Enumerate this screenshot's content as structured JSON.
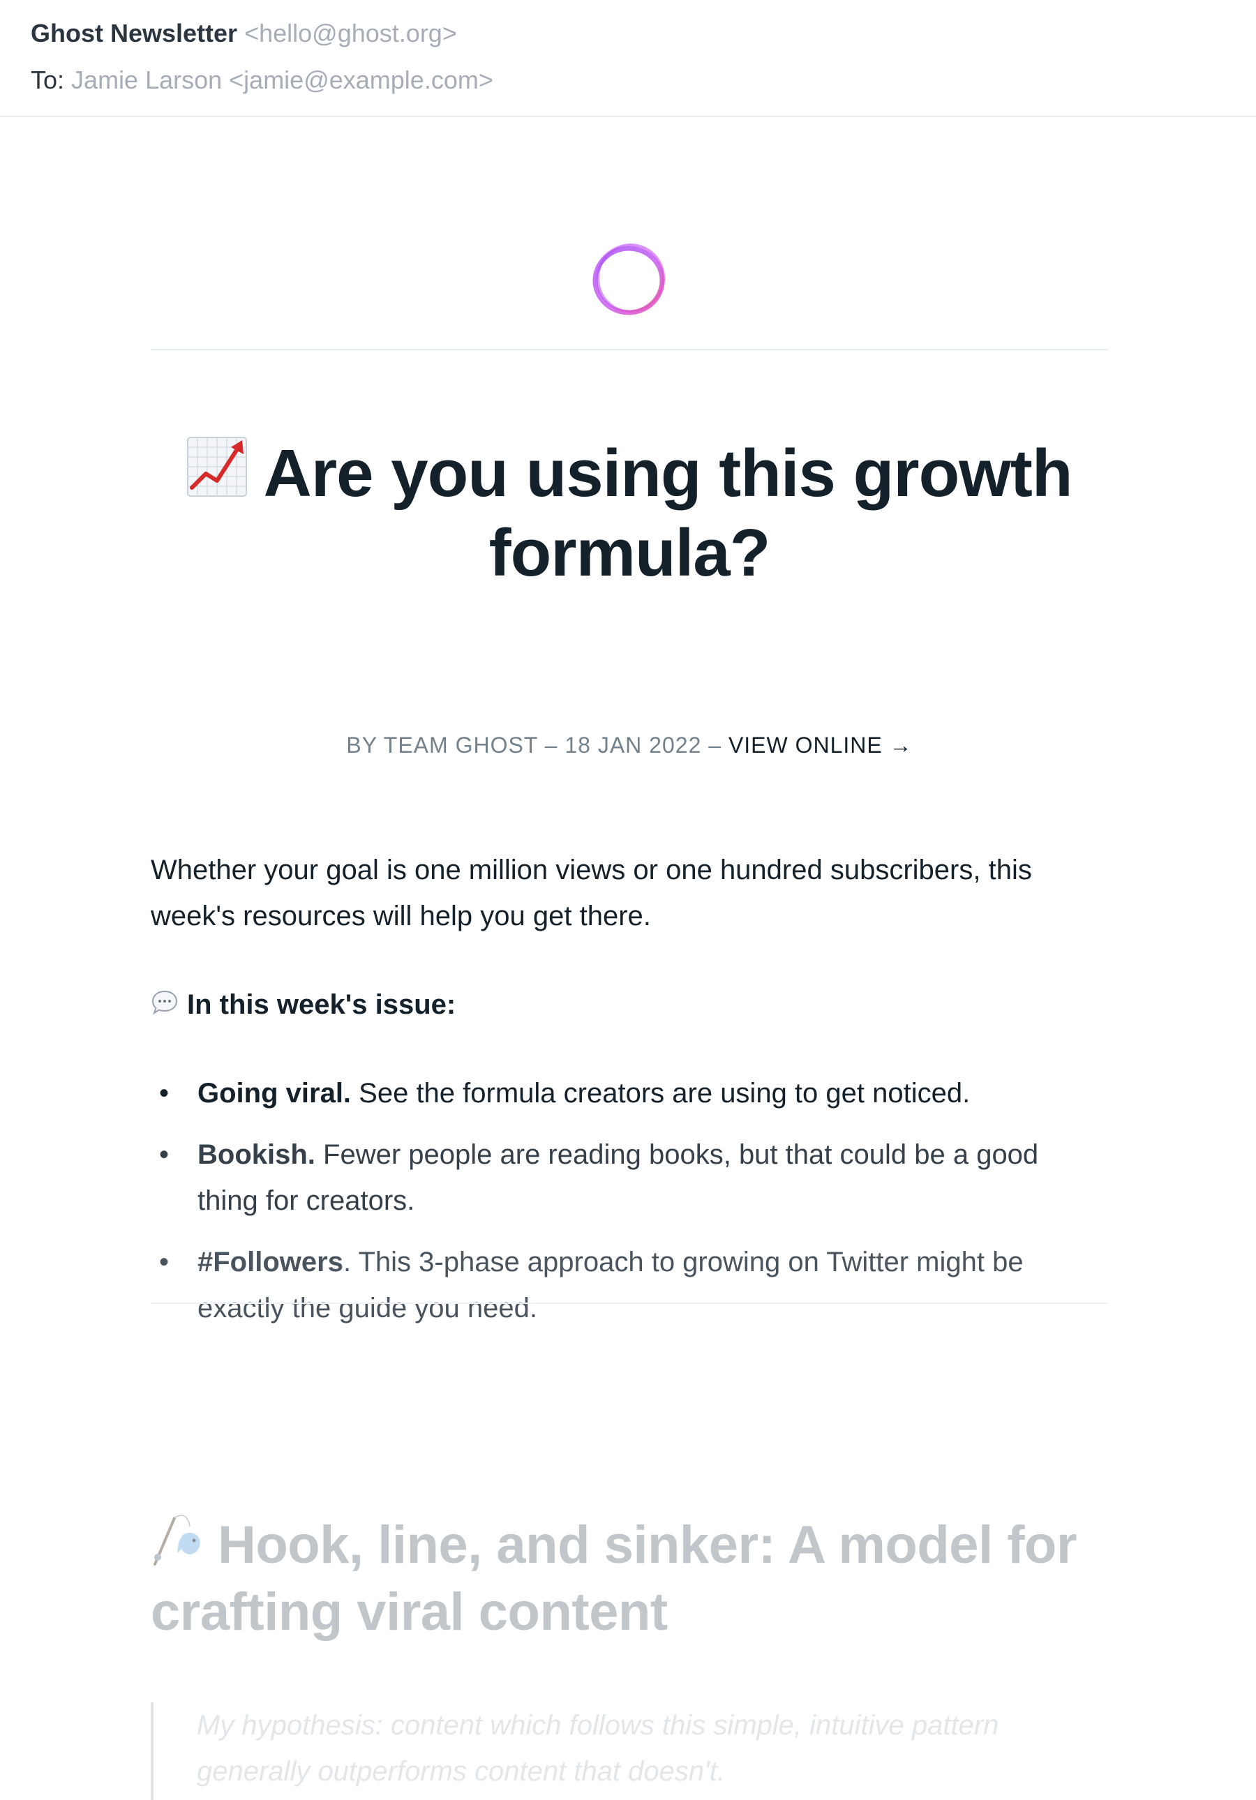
{
  "email": {
    "sender_name": "Ghost Newsletter",
    "sender_email": "<hello@ghost.org>",
    "to_label": "To:",
    "to_value": "Jamie Larson <jamie@example.com>"
  },
  "newsletter": {
    "logo_icon": "ghost-ring-logo-icon",
    "title_emoji": "chart-increasing-icon",
    "title": "Are you using this growth formula?",
    "byline_prefix": "BY TEAM GHOST – 18 JAN 2022 – ",
    "view_online": "VIEW ONLINE →",
    "intro": "Whether your goal is one million views or one hundred subscribers, this week's resources will help you get there.",
    "issue_emoji": "speech-bubble-icon",
    "issue_heading": "In this week's issue:",
    "items": [
      {
        "lead": "Going viral.",
        "text": " See the formula creators are using to get noticed."
      },
      {
        "lead": "Bookish.",
        "text": " Fewer people are reading books, but that could be a good thing for creators."
      },
      {
        "lead": "#Followers",
        "text": ". This 3-phase approach to growing on Twitter might be exactly the guide you need."
      }
    ],
    "section_emoji": "fishing-pole-icon",
    "section_title": "Hook, line, and sinker: A model for crafting viral content",
    "quote": "My hypothesis: content which follows this simple, intuitive pattern generally outperforms content that doesn't."
  },
  "colors": {
    "logo_purple": "#a855f7",
    "logo_pink": "#ec4899",
    "text_dark": "#15212a",
    "text_muted": "#73818c",
    "header_muted": "#a7adb6"
  }
}
